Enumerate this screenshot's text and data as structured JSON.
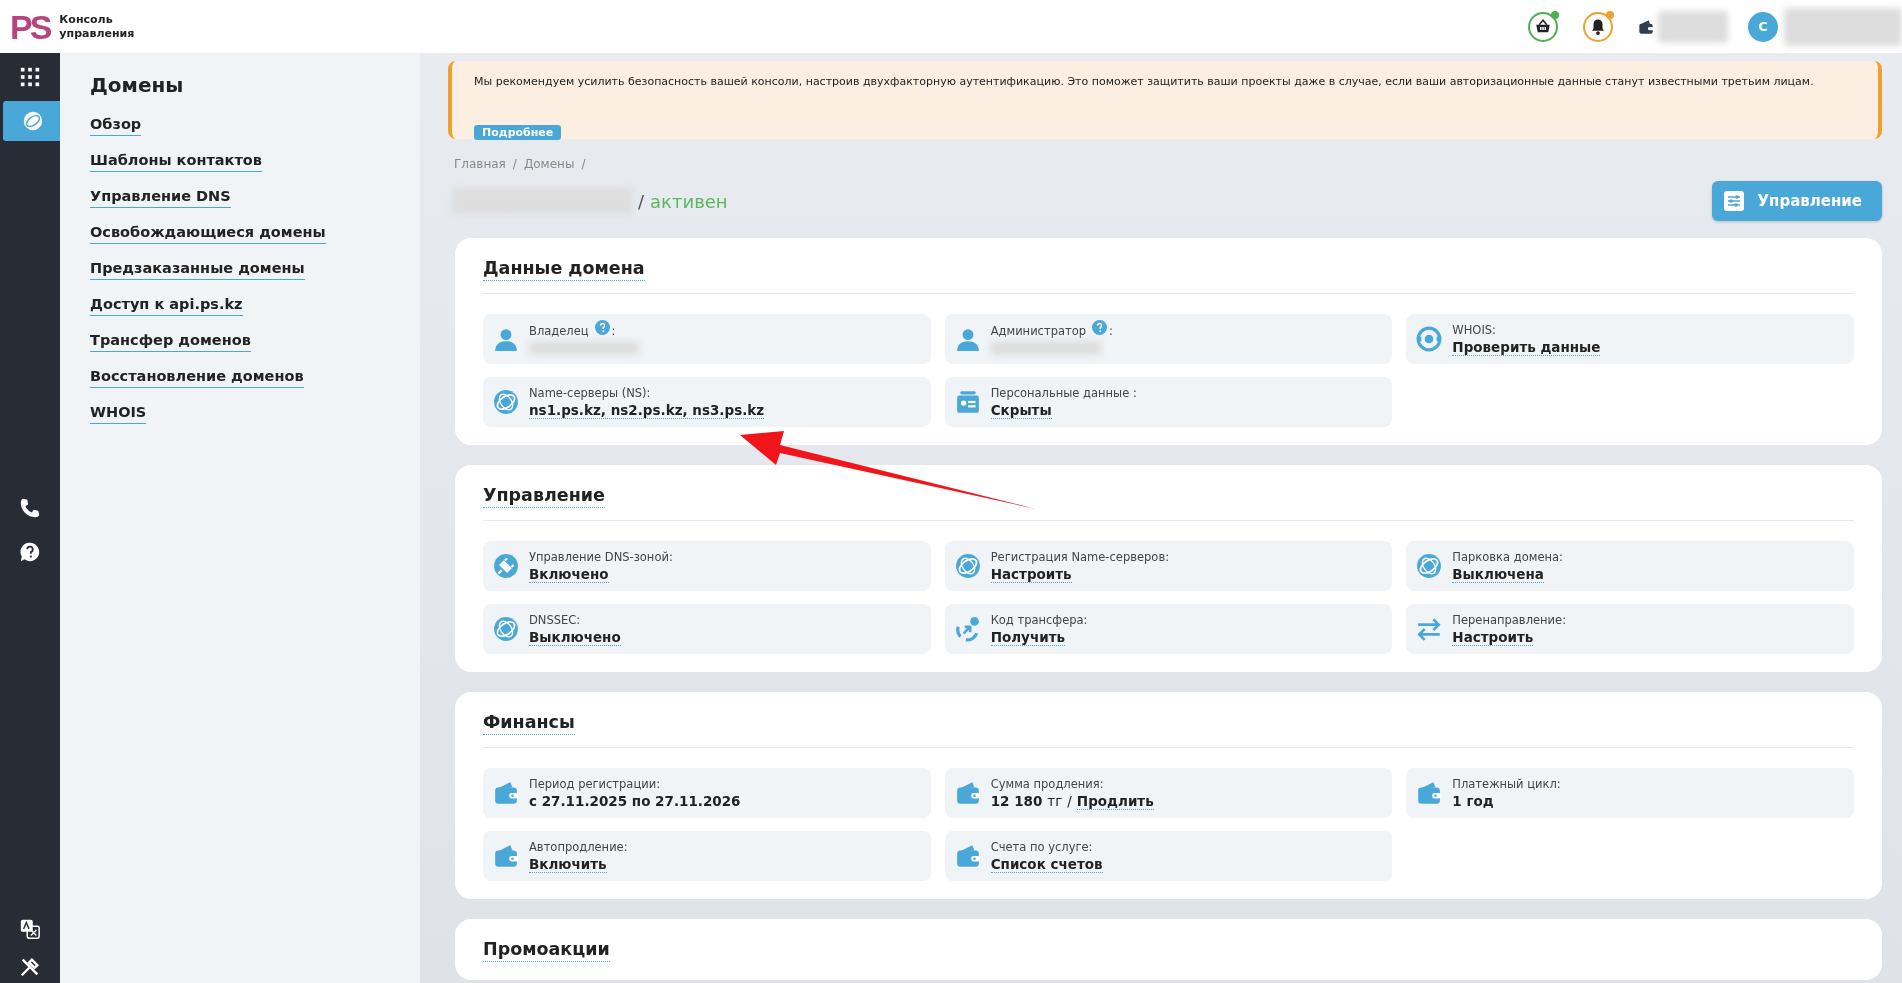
{
  "header": {
    "logo": "PS",
    "title": "Консоль управления",
    "actions": [
      {
        "kind": "cart",
        "color": "#4caf50"
      },
      {
        "kind": "bell",
        "color": "#f0a030"
      },
      {
        "kind": "wallet"
      },
      {
        "kind": "redacted"
      }
    ],
    "avatar": "С"
  },
  "rail": {
    "top": [
      {
        "kind": "apps",
        "selected": false
      },
      {
        "kind": "globe",
        "selected": true
      }
    ],
    "middle": [
      {
        "kind": "phone"
      },
      {
        "kind": "help"
      }
    ],
    "bottom": [
      {
        "kind": "translate"
      },
      {
        "kind": "tools"
      }
    ]
  },
  "submenu": {
    "title": "Домены",
    "items": [
      "Обзор",
      "Шаблоны контактов",
      "Управление DNS",
      "Освобождающиеся домены",
      "Предзаказанные домены",
      "Доступ к api.ps.kz",
      "Трансфер доменов",
      "Восстановление доменов",
      "WHOIS"
    ]
  },
  "alert": {
    "text": "Мы рекомендуем усилить безопасность вашей консоли, настроив двухфакторную аутентификацию. Это поможет защитить ваши проекты даже в случае, если ваши авторизационные данные станут известными третьим лицам.",
    "button": "Подробнее"
  },
  "breadcrumb": {
    "items": [
      "Главная",
      "Домены"
    ],
    "separator": "/"
  },
  "domain": {
    "separator": "/",
    "status": "активен"
  },
  "manage_button": "Управление",
  "sections": [
    {
      "title": "Данные домена",
      "items": [
        {
          "kind": "user",
          "label": "Владелец",
          "help": true,
          "suffix": ":",
          "value": [
            {
              "kind": "redacted"
            }
          ]
        },
        {
          "kind": "user",
          "label": "Администратор",
          "help": true,
          "suffix": ":",
          "value": [
            {
              "kind": "redacted"
            }
          ]
        },
        {
          "kind": "whois",
          "label": "WHOIS:",
          "value": [
            {
              "kind": "link",
              "text": "Проверить данные"
            }
          ]
        },
        {
          "kind": "globe",
          "label": "Name-серверы (NS):",
          "value": [
            {
              "kind": "link",
              "text": "ns1.ps.kz, ns2.ps.kz, ns3.ps.kz"
            }
          ]
        },
        {
          "kind": "card",
          "label": "Персональные данные  :",
          "value": [
            {
              "kind": "link",
              "text": "Скрыты"
            }
          ]
        }
      ]
    },
    {
      "title": "Управление",
      "items": [
        {
          "kind": "plug",
          "label": "Управление DNS-зоной:",
          "value": [
            {
              "kind": "link",
              "text": "Включено"
            }
          ]
        },
        {
          "kind": "globe",
          "label": "Регистрация Name-серверов:",
          "value": [
            {
              "kind": "link",
              "text": "Настроить"
            }
          ]
        },
        {
          "kind": "globe",
          "label": "Парковка домена:",
          "value": [
            {
              "kind": "link",
              "text": "Выключена"
            }
          ]
        },
        {
          "kind": "globe",
          "label": "DNSSEC:",
          "value": [
            {
              "kind": "link",
              "text": "Выключено"
            }
          ]
        },
        {
          "kind": "transfer",
          "label": "Код трансфера:",
          "value": [
            {
              "kind": "link",
              "text": "Получить"
            }
          ]
        },
        {
          "kind": "arrows",
          "label": "Перенаправление:",
          "value": [
            {
              "kind": "link",
              "text": "Настроить"
            }
          ]
        }
      ]
    },
    {
      "title": "Финансы",
      "items": [
        {
          "kind": "wallet",
          "label": "Период регистрации:",
          "value": [
            {
              "kind": "bold",
              "text": "с 27.11.2025 по 27.11.2026"
            }
          ]
        },
        {
          "kind": "wallet",
          "label": "Сумма продления:",
          "value": [
            {
              "kind": "bold",
              "text": "12 180"
            },
            {
              "kind": "plain",
              "text": "тг"
            },
            {
              "kind": "plain",
              "text": "/"
            },
            {
              "kind": "link",
              "text": "Продлить"
            }
          ]
        },
        {
          "kind": "wallet",
          "label": "Платежный цикл:",
          "value": [
            {
              "kind": "bold",
              "text": "1 год"
            }
          ]
        },
        {
          "kind": "wallet",
          "label": "Автопродление:",
          "value": [
            {
              "kind": "link",
              "text": "Включить"
            }
          ]
        },
        {
          "kind": "wallet",
          "label": "Счета по услуге:",
          "value": [
            {
              "kind": "link",
              "text": "Список счетов"
            }
          ]
        }
      ]
    },
    {
      "title": "Промоакции"
    }
  ]
}
